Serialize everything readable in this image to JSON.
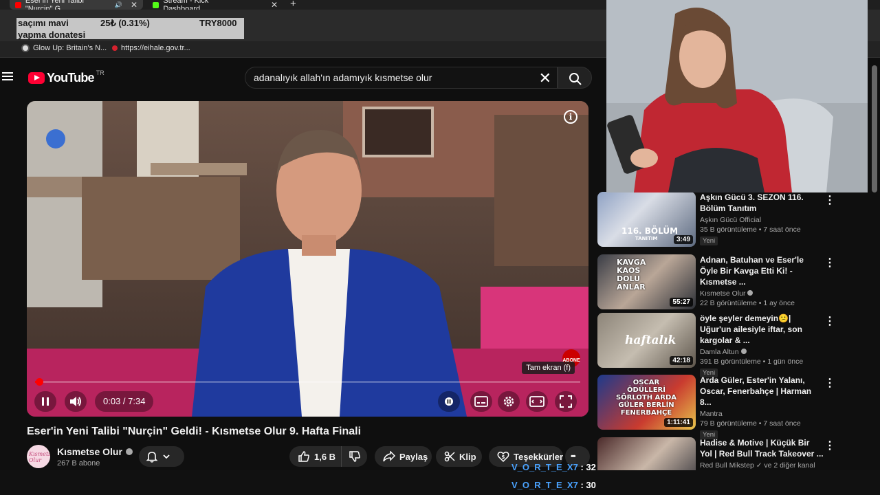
{
  "browser": {
    "tabs": [
      {
        "title": "Eser'in Yeni Talibi \"Nurçin\" G",
        "close": "✕",
        "audio_icon": "🔊"
      },
      {
        "title": "Stream - Kick Dashboard",
        "close": "✕"
      }
    ],
    "new_tab": "+",
    "bookmarks": [
      {
        "label": "Glow Up: Britain's N..."
      },
      {
        "label": "https://eihale.gov.tr..."
      }
    ]
  },
  "donation_overlay": {
    "message_line1": "saçımı mavi",
    "message_line2": "yapma donatesi",
    "amount": "25₺ (0.31%)",
    "goal": "TRY8000"
  },
  "youtube": {
    "logo_text": "YouTube",
    "country_code": "TR",
    "search_query": "adanalıyık allah'ın adamıyık kısmetse olur",
    "search_clear": "✕"
  },
  "player": {
    "time": "0:03 / 7:34",
    "progress_fraction": 0.007,
    "info": "i",
    "fullscreen_tooltip": "Tam ekran (f)",
    "abone_badge": "ABONE"
  },
  "video": {
    "title": "Eser'in Yeni Talibi \"Nurçin\" Geldi! - Kısmetse Olur 9. Hafta Finali",
    "channel": "Kısmetse Olur",
    "subscribers": "267 B abone",
    "avatar_text": "Kısmetse Olur",
    "likes": "1,6 B",
    "share": "Paylaş",
    "clip": "Klip",
    "thanks": "Teşekkürler",
    "more": "•••"
  },
  "recommendations": [
    {
      "title": "Aşkın Gücü 3. SEZON 116. Bölüm Tanıtım",
      "channel": "Aşkın Gücü Official",
      "stats": "35 B görüntüleme • 7 saat önce",
      "badge": "Yeni",
      "duration": "3:49",
      "thumb_caption": "116. BÖLÜM",
      "thumb_sub": "TANITIM"
    },
    {
      "title": "Adnan, Batuhan ve Eser'le Öyle Bir Kavga Etti Ki! - Kısmetse ...",
      "channel": "Kısmetse Olur",
      "stats": "22 B görüntüleme • 1 ay önce",
      "badge": "",
      "duration": "55:27",
      "thumb_caption": "KAVGA KAOS DOLU ANLAR"
    },
    {
      "title": "öyle şeyler demeyin😕| Uğur'un ailesiyle iftar, son kargolar & ...",
      "channel": "Damla Altun",
      "stats": "391 B görüntüleme • 1 gün önce",
      "badge": "Yeni",
      "duration": "42:18",
      "thumb_caption": "haftalık"
    },
    {
      "title": "Arda Güler, Ester'in Yalanı, Oscar, Fenerbahçe | Harman 8...",
      "channel": "Mantra",
      "stats": "79 B görüntüleme • 7 saat önce",
      "badge": "Yeni",
      "duration": "1:11:41",
      "thumb_caption": "OSCAR ÖDÜLLERİ SÖRLOTH ARDA GÜLER BERLİN FENERBAHÇE"
    },
    {
      "title": "Hadise & Motive | Küçük Bir Yol | Red Bull Track Takeover ...",
      "channel": "Red Bull Mikstep ✓ ve 2 diğer kanal",
      "stats": "",
      "badge": "",
      "duration": "",
      "thumb_caption": ""
    }
  ],
  "scoreboard": [
    {
      "name": "V_O_R_T_E_X7",
      "points": ": 32"
    },
    {
      "name": "V_O_R_T_E_X7",
      "points": ": 30"
    }
  ],
  "colors": {
    "accent": "#ff0000",
    "background": "#0f0f0f",
    "text": "#f1f1f1",
    "secondary": "#aaaaaa"
  }
}
